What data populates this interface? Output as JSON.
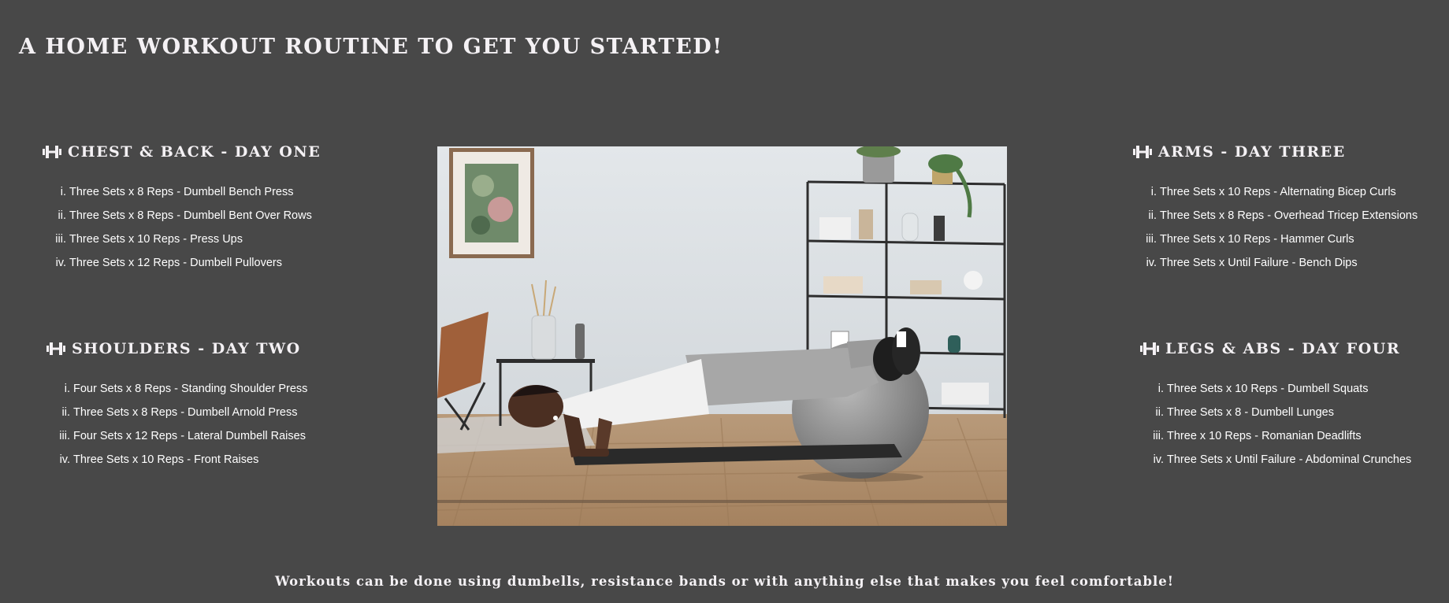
{
  "page": {
    "title": "A HOME WORKOUT ROUTINE TO GET YOU STARTED!",
    "footer": "Workouts can be done using dumbells, resistance bands or with anything else that makes you feel comfortable!"
  },
  "colors": {
    "background": "#484848",
    "heading": "#f4f1f4",
    "text": "#ffffff"
  },
  "days": [
    {
      "icon": "dumbbell-icon",
      "heading": "CHEST & BACK - DAY ONE",
      "exercises": [
        {
          "num": "i.",
          "text": "Three Sets x 8 Reps - Dumbell Bench Press"
        },
        {
          "num": "ii.",
          "text": "Three Sets x 8 Reps - Dumbell Bent Over Rows"
        },
        {
          "num": "iii.",
          "text": "Three Sets x 10 Reps - Press Ups"
        },
        {
          "num": "iv.",
          "text": "Three Sets x 12 Reps - Dumbell Pullovers"
        }
      ]
    },
    {
      "icon": "dumbbell-icon",
      "heading": "SHOULDERS - DAY TWO",
      "exercises": [
        {
          "num": "i.",
          "text": "Four Sets x 8 Reps - Standing Shoulder Press"
        },
        {
          "num": "ii.",
          "text": "Three Sets x 8 Reps - Dumbell Arnold Press"
        },
        {
          "num": "iii.",
          "text": "Four Sets x 12 Reps - Lateral Dumbell Raises"
        },
        {
          "num": "iv.",
          "text": "Three Sets x 10 Reps - Front Raises"
        }
      ]
    },
    {
      "icon": "dumbbell-icon",
      "heading": "ARMS - DAY THREE",
      "exercises": [
        {
          "num": "i.",
          "text": "Three Sets x 10 Reps - Alternating Bicep Curls"
        },
        {
          "num": "ii.",
          "text": "Three Sets x 8 Reps - Overhead Tricep Extensions"
        },
        {
          "num": "iii.",
          "text": "Three Sets x 10 Reps - Hammer Curls"
        },
        {
          "num": "iv.",
          "text": "Three Sets x Until Failure - Bench Dips"
        }
      ]
    },
    {
      "icon": "dumbbell-icon",
      "heading": "LEGS & ABS - DAY FOUR",
      "exercises": [
        {
          "num": "i.",
          "text": "Three Sets x 10 Reps - Dumbell Squats"
        },
        {
          "num": "ii.",
          "text": "Three Sets x 8 - Dumbell Lunges"
        },
        {
          "num": "iii.",
          "text": "Three x 10 Reps - Romanian Deadlifts"
        },
        {
          "num": "iv.",
          "text": "Three Sets x Until Failure - Abdominal Crunches"
        }
      ]
    }
  ]
}
